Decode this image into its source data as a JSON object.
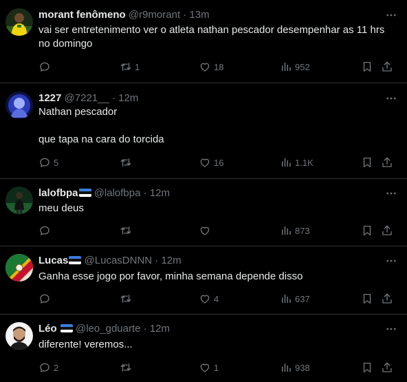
{
  "tweets": [
    {
      "name": "morant fenômeno",
      "flag": false,
      "handle": "@r9morant",
      "dot": "·",
      "time": "13m",
      "lines": [
        "vai ser entretenimento ver o atleta nathan pescador desempenhar as 11 hrs",
        "no domingo"
      ],
      "replies": "",
      "retweets": "1",
      "likes": "18",
      "views": "952"
    },
    {
      "name": "1227",
      "flag": false,
      "handle": "@7221__",
      "dot": "·",
      "time": "12m",
      "lines": [
        "Nathan pescador",
        "",
        "que tapa na cara do torcida"
      ],
      "replies": "5",
      "retweets": "",
      "likes": "16",
      "views": "1.1K"
    },
    {
      "name": "lalofbpa",
      "flag": true,
      "handle": "@lalofbpa",
      "dot": "·",
      "time": "12m",
      "lines": [
        "meu deus"
      ],
      "replies": "",
      "retweets": "",
      "likes": "",
      "views": "873"
    },
    {
      "name": "Lucas",
      "flag": true,
      "handle": "@LucasDNNN",
      "dot": "·",
      "time": "12m",
      "lines": [
        "Ganha esse jogo por favor, minha semana depende disso"
      ],
      "replies": "",
      "retweets": "",
      "likes": "4",
      "views": "637"
    },
    {
      "name": "Léo",
      "flag": true,
      "handle": "@leo_gduarte",
      "dot": "·",
      "time": "12m",
      "lines": [
        "diferente! veremos..."
      ],
      "replies": "2",
      "retweets": "",
      "likes": "1",
      "views": "938"
    }
  ],
  "icons": {
    "reply": "reply-icon",
    "retweet": "retweet-icon",
    "like": "heart-icon",
    "views": "views-icon",
    "bookmark": "bookmark-icon",
    "share": "share-icon",
    "more": "more-icon"
  },
  "colors": {
    "background": "#000000",
    "text": "#e7e9ea",
    "muted": "#71767b",
    "divider": "#2f3336"
  }
}
